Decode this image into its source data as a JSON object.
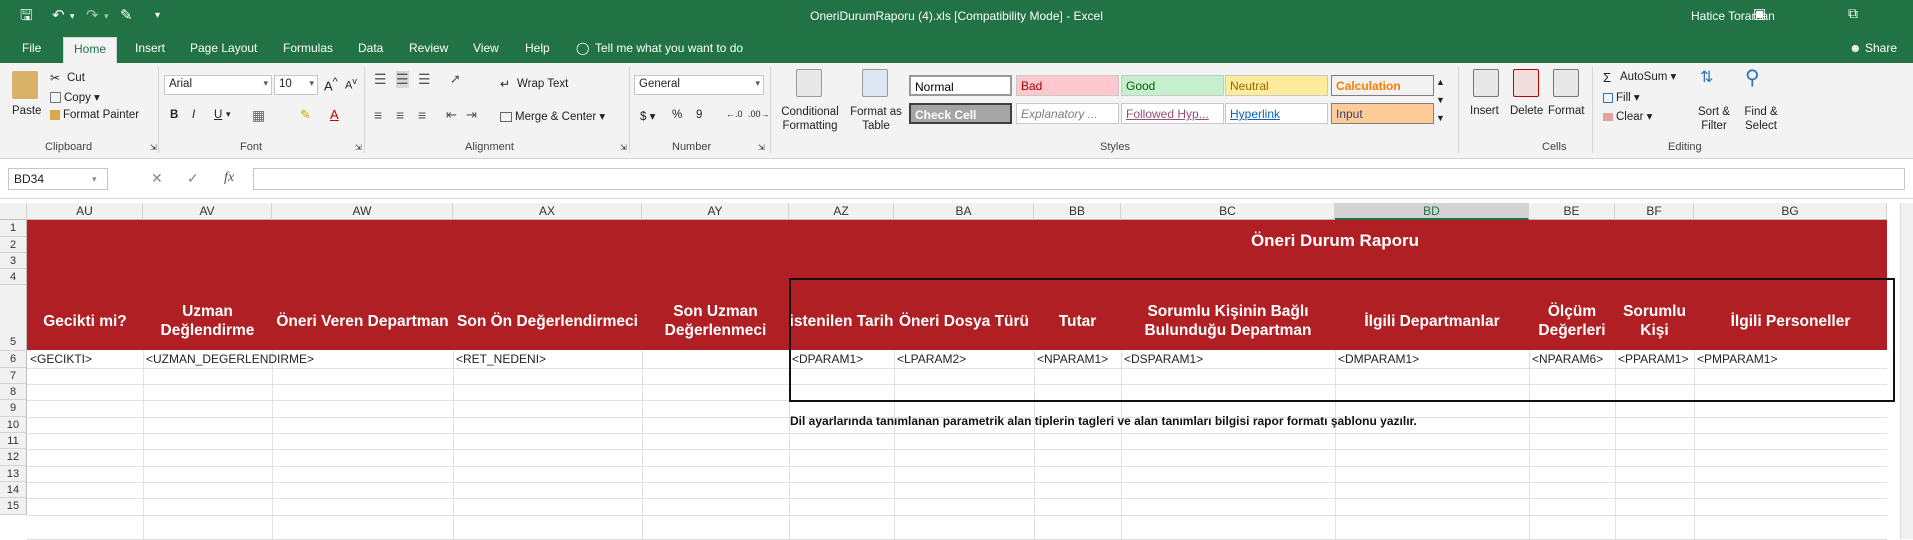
{
  "window": {
    "title": "OneriDurumRaporu (4).xls  [Compatibility Mode]  -  Excel",
    "user": "Hatice Toraman"
  },
  "qat": {
    "save_icon": "save-icon",
    "undo_icon": "undo-icon",
    "redo_icon": "redo-icon",
    "customize_icon": "customize-icon"
  },
  "tabs": [
    "File",
    "Home",
    "Insert",
    "Page Layout",
    "Formulas",
    "Data",
    "Review",
    "View",
    "Help"
  ],
  "tell_me": "Tell me what you want to do",
  "share": "Share",
  "clipboard": {
    "paste": "Paste",
    "cut": "Cut",
    "copy": "Copy",
    "format_painter": "Format Painter",
    "label": "Clipboard"
  },
  "font": {
    "name": "Arial",
    "size": "10",
    "label": "Font",
    "bold": "B",
    "italic": "I",
    "underline": "U"
  },
  "alignment": {
    "wrap_text": "Wrap Text",
    "merge_center": "Merge & Center",
    "label": "Alignment"
  },
  "number": {
    "format": "General",
    "label": "Number",
    "currency": "$",
    "percent": "%",
    "comma": "9"
  },
  "styles": {
    "conditional": "Conditional Formatting",
    "format_table": "Format as Table",
    "label": "Styles",
    "cells": [
      {
        "text": "Normal",
        "bg": "#ffffff",
        "fg": "#000000"
      },
      {
        "text": "Bad",
        "bg": "#ffc7ce",
        "fg": "#9c0006"
      },
      {
        "text": "Good",
        "bg": "#c6efce",
        "fg": "#006100"
      },
      {
        "text": "Neutral",
        "bg": "#ffeb9c",
        "fg": "#9c6500"
      },
      {
        "text": "Calculation",
        "bg": "#f2f2f2",
        "fg": "#fa7d00"
      },
      {
        "text": "Check Cell",
        "bg": "#a5a5a5",
        "fg": "#ffffff"
      },
      {
        "text": "Explanatory ...",
        "bg": "#ffffff",
        "fg": "#7f7f7f"
      },
      {
        "text": "Followed Hyp...",
        "bg": "#ffffff",
        "fg": "#954f72"
      },
      {
        "text": "Hyperlink",
        "bg": "#ffffff",
        "fg": "#0563c1"
      },
      {
        "text": "Input",
        "bg": "#ffcc99",
        "fg": "#3f3f76"
      }
    ]
  },
  "cells_group": {
    "insert": "Insert",
    "delete": "Delete",
    "format": "Format",
    "label": "Cells"
  },
  "editing": {
    "autosum": "AutoSum",
    "fill": "Fill",
    "clear": "Clear",
    "sort_filter": "Sort & Filter",
    "find_select": "Find & Select",
    "label": "Editing"
  },
  "formula_bar": {
    "name_box": "BD34",
    "fx": "fx",
    "formula": ""
  },
  "columns": [
    "AU",
    "AV",
    "AW",
    "AX",
    "AY",
    "AZ",
    "BA",
    "BB",
    "BC",
    "BD",
    "BE",
    "BF",
    "BG"
  ],
  "selected_column": "BD",
  "rows": [
    "1",
    "2",
    "3",
    "4",
    "5",
    "6",
    "7",
    "8",
    "9",
    "10",
    "11",
    "12",
    "13",
    "14",
    "15"
  ],
  "sheet": {
    "title": "Öneri Durum Raporu",
    "headers": [
      "Gecikti mi?",
      "Uzman Değlendirme",
      "Öneri Veren Departman",
      "Son Ön Değerlendirmeci",
      "Son Uzman Değerlenmeci",
      "istenilen Tarih",
      "Öneri Dosya Türü",
      "Tutar",
      "Sorumlu Kişinin Bağlı Bulunduğu Departman",
      "İlgili Departmanlar",
      "Ölçüm Değerleri",
      "Sorumlu Kişi",
      "İlgili Personeller"
    ],
    "row6": [
      "<GECIKTI>",
      "<UZMAN_DEGERLENDIRME>",
      "",
      "<RET_NEDENI>",
      "",
      "<DPARAM1>",
      "<LPARAM2>",
      "<NPARAM1>",
      "<DSPARAM1>",
      "<DMPARAM1>",
      "<NPARAM6>",
      "<PPARAM1>",
      "<PMPARAM1>"
    ],
    "note": "Dil ayarlarında tanımlanan parametrik alan tiplerin tagleri ve alan tanımları bilgisi rapor formatı şablonu yazılır."
  },
  "colors": {
    "excel_green": "#217346",
    "header_red": "#b01f24"
  }
}
